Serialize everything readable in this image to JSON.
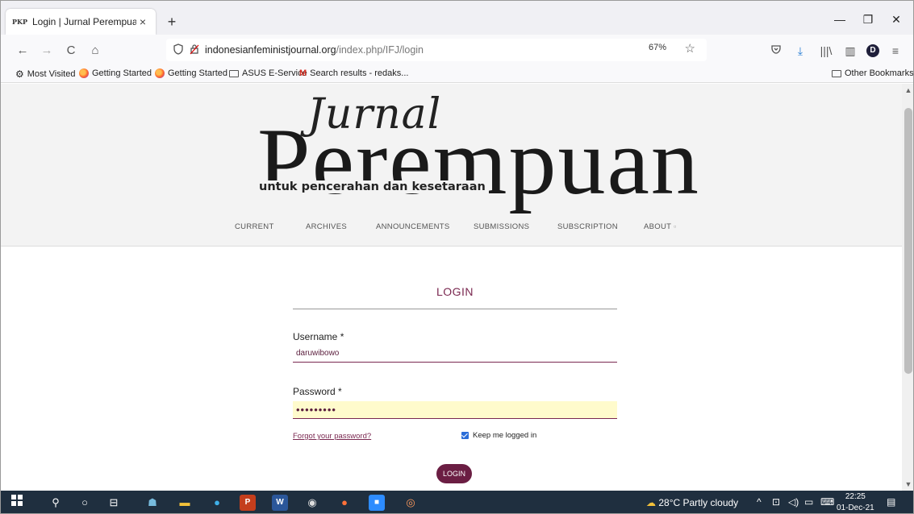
{
  "browser": {
    "tab": {
      "favicon": "PKP",
      "title": "Login | Jurnal Perempuan",
      "close": "×"
    },
    "new_tab": "+",
    "window_controls": {
      "minimize": "—",
      "restore": "❐",
      "close": "✕"
    },
    "nav": {
      "back": "←",
      "forward": "→",
      "reload": "C",
      "home": "⌂"
    },
    "url": {
      "host": "indonesianfeministjournal.org",
      "path": "/index.php/IFJ/login"
    },
    "zoom": "67%",
    "toolbar_icons": [
      "pocket-icon",
      "download-icon",
      "library-icon",
      "sidebar-icon",
      "account-icon",
      "menu-icon"
    ],
    "account_initial": "D",
    "bookmarks": [
      {
        "label": "Most Visited",
        "icon": "gear-icon"
      },
      {
        "label": "Getting Started",
        "icon": "firefox-icon"
      },
      {
        "label": "Getting Started",
        "icon": "firefox-icon"
      },
      {
        "label": "ASUS E-Service",
        "icon": "folder-icon"
      },
      {
        "label": "Search results - redaks...",
        "icon": "gmail-icon"
      }
    ],
    "other_bookmarks": "Other Bookmarks"
  },
  "site": {
    "logo_script": "Jurnal",
    "logo_main": "Perempuan",
    "tagline": "untuk pencerahan dan kesetaraan",
    "nav": [
      "CURRENT",
      "ARCHIVES",
      "ANNOUNCEMENTS",
      "SUBMISSIONS",
      "SUBSCRIPTION",
      "ABOUT"
    ]
  },
  "login": {
    "title": "LOGIN",
    "username_label": "Username *",
    "username_value": "daruwibowo",
    "password_label": "Password *",
    "password_value": "•••••••••",
    "forgot": "Forgot your password?",
    "keep_logged_in": "Keep me logged in",
    "keep_checked": true,
    "button": "LOGIN"
  },
  "taskbar": {
    "weather": "28°C  Partly cloudy",
    "time": "22:25",
    "date": "01-Dec-21"
  },
  "colors": {
    "accent": "#6b1e43",
    "link": "#7a2850",
    "taskbar": "#1f2f3f",
    "header_bg": "#f3f3f3"
  }
}
